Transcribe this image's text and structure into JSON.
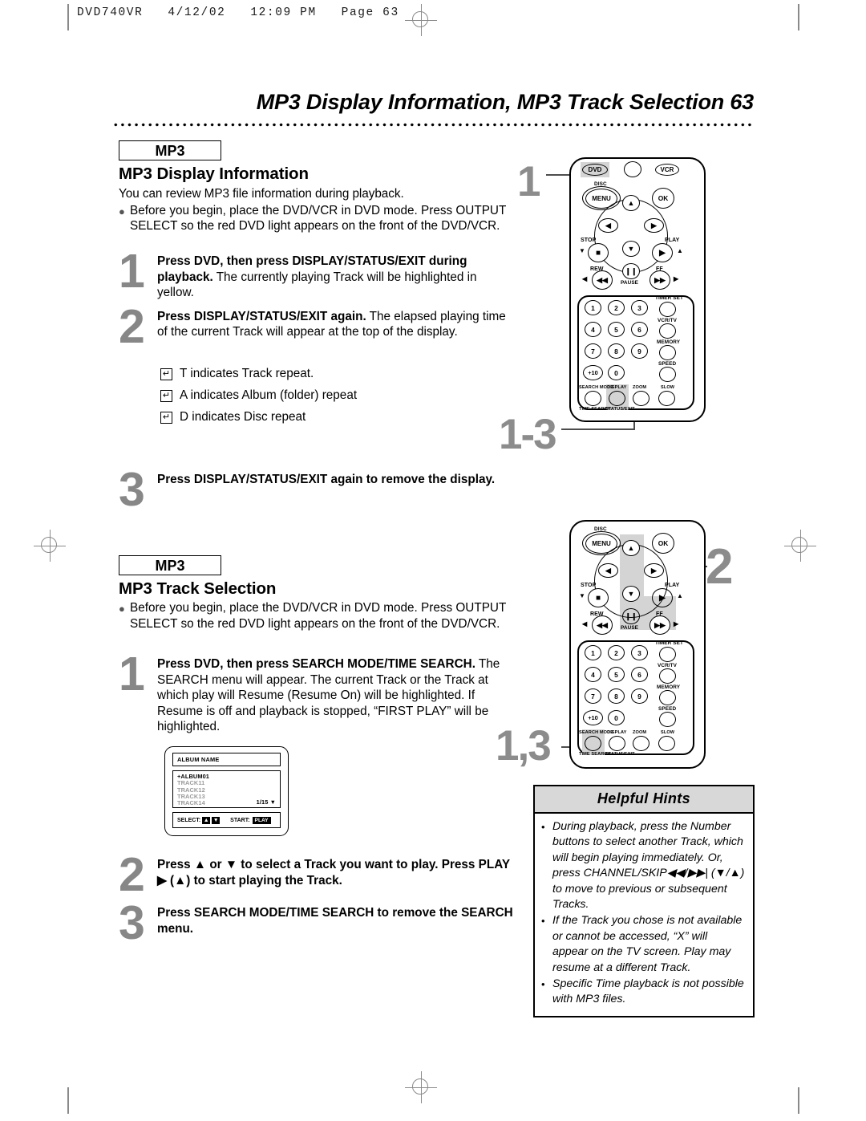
{
  "page_header": "DVD740VR   4/12/02   12:09 PM   Page 63",
  "title": "MP3 Display Information, MP3 Track Selection  63",
  "section1": {
    "tag": "MP3",
    "heading": "MP3 Display Information",
    "intro": "You can review MP3 file information during playback.",
    "bullet": "Before you begin, place the DVD/VCR in DVD mode. Press OUTPUT SELECT so the red DVD light appears on the front of the DVD/VCR.",
    "steps": [
      {
        "num": "1",
        "bold": "Press DVD, then press DISPLAY/STATUS/EXIT during playback.",
        "rest": " The currently playing Track will be highlighted in yellow."
      },
      {
        "num": "2",
        "bold": "Press DISPLAY/STATUS/EXIT again.",
        "rest": " The elapsed playing time of the current Track will appear at the top of the display."
      },
      {
        "num": "3",
        "bold": "Press DISPLAY/STATUS/EXIT again to remove the display.",
        "rest": ""
      }
    ],
    "repeat_items": [
      {
        "icon": "repeat-loop-icon",
        "text": "T indicates Track repeat."
      },
      {
        "icon": "repeat-loop-icon",
        "text": "A indicates Album (folder) repeat"
      },
      {
        "icon": "repeat-loop-icon",
        "text": "D indicates Disc repeat"
      }
    ]
  },
  "section2": {
    "tag": "MP3",
    "heading": "MP3 Track Selection",
    "bullet": "Before you begin, place the DVD/VCR in DVD mode. Press OUTPUT SELECT so the red DVD light appears on the front of the DVD/VCR.",
    "steps": [
      {
        "num": "1",
        "bold": "Press DVD, then press SEARCH MODE/TIME SEARCH.",
        "rest": " The SEARCH menu will appear. The current Track or the Track at which play will Resume (Resume On) will be highlighted. If Resume is off and playback is stopped, “FIRST PLAY” will be highlighted."
      },
      {
        "num": "2",
        "bold": "Press ▲ or ▼ to select a Track you want to play. Press PLAY ▶ (▲) to start playing the Track.",
        "rest": ""
      },
      {
        "num": "3",
        "bold": "Press SEARCH MODE/TIME SEARCH to remove the SEARCH menu.",
        "rest": ""
      }
    ]
  },
  "tv_screen": {
    "album_name": "ALBUM NAME",
    "rows": [
      {
        "text": "+ALBUM01",
        "selected": true
      },
      {
        "text": "TRACK11",
        "selected": false
      },
      {
        "text": "TRACK12",
        "selected": false
      },
      {
        "text": "TRACK13",
        "selected": false
      },
      {
        "text": "TRACK14",
        "selected": false
      }
    ],
    "page_indicator": "1/15 ▼",
    "select_label": "SELECT:",
    "start_label": "START:",
    "start_value": "PLAY"
  },
  "hints": {
    "title": "Helpful Hints",
    "items": [
      "During playback, press the Number buttons to select another Track, which will begin playing immediately. Or, press CHANNEL/SKIP◀◀/▶▶| (▼/▲) to move to previous or subsequent Tracks.",
      "If the Track you chose is not available or cannot be accessed, “X” will appear on the TV screen. Play may resume at a different Track.",
      "Specific Time playback is not possible with MP3 files."
    ]
  },
  "callouts": {
    "top": "1",
    "mid": "1-3",
    "lower": "2",
    "bottom": "1,3"
  },
  "remote": {
    "mode_buttons": [
      {
        "label": "DVD",
        "highlighted": true
      },
      {
        "label": "VCR",
        "highlighted": false
      }
    ],
    "menu_label": "MENU",
    "disc_label": "DISC",
    "ok_label": "OK",
    "stop_label": "STOP",
    "play_label": "PLAY",
    "rew_label": "REW",
    "ff_label": "FF",
    "pause_label": "PAUSE",
    "numbers": [
      "1",
      "2",
      "3",
      "4",
      "5",
      "6",
      "7",
      "8",
      "9",
      "+10",
      "0"
    ],
    "side_labels": [
      "TIMER SET",
      "VCR/TV",
      "MEMORY",
      "SPEED"
    ],
    "bottom_labels_top": [
      "SEARCH MODE",
      "DISPLAY",
      "ZOOM",
      "SLOW"
    ],
    "bottom_labels_bot": [
      "TIME SEARCH",
      "STATUS/EXIT"
    ]
  }
}
